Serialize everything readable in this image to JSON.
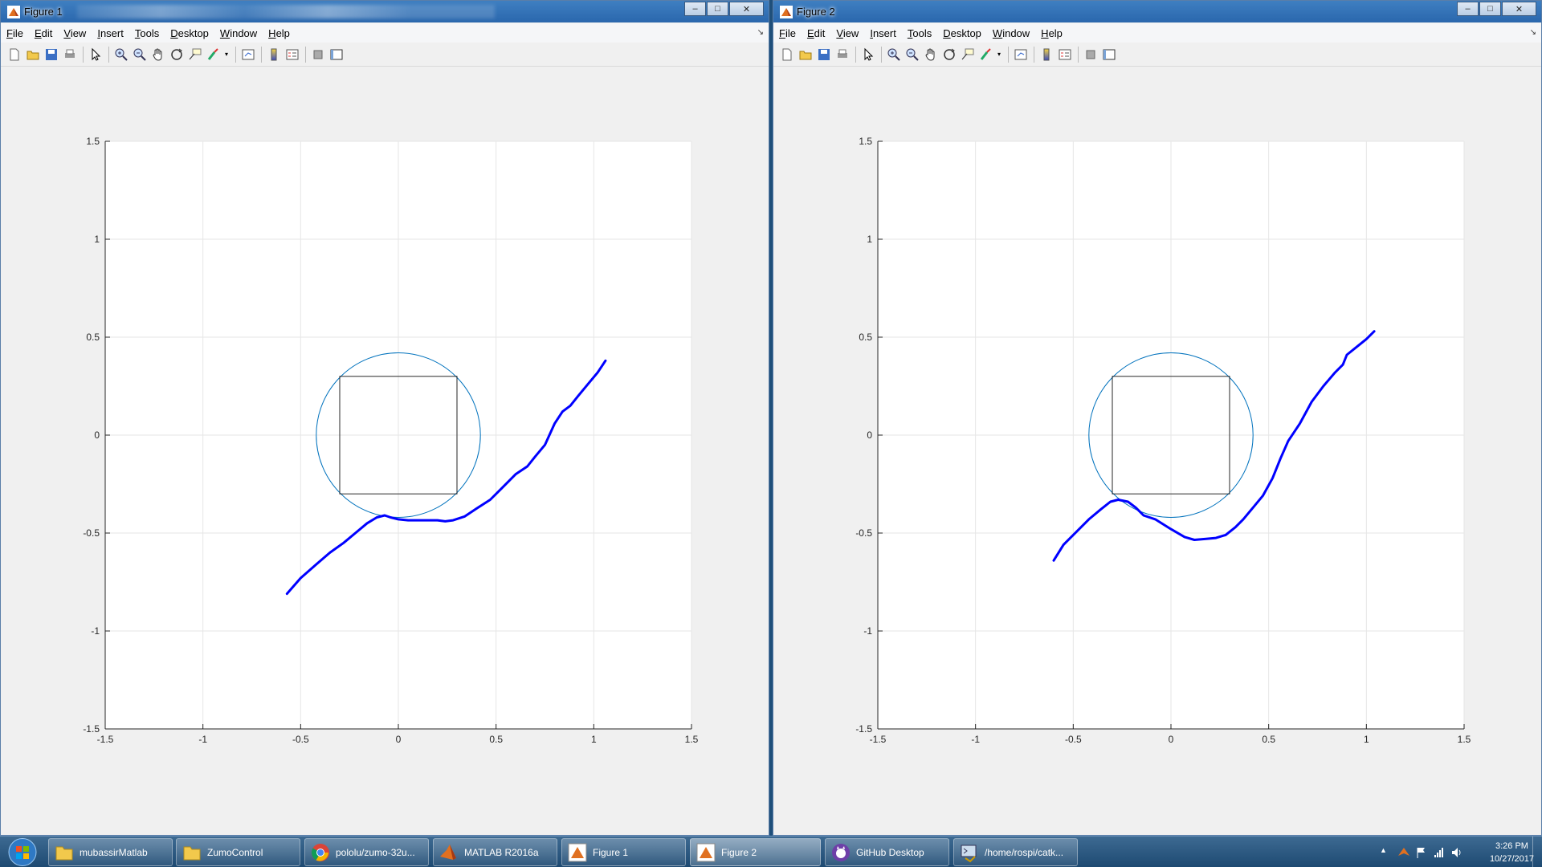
{
  "windows": [
    {
      "title": "Figure 1",
      "menu": [
        "File",
        "Edit",
        "View",
        "Insert",
        "Tools",
        "Desktop",
        "Window",
        "Help"
      ],
      "chart_data": {
        "type": "line",
        "title": "",
        "xlabel": "",
        "ylabel": "",
        "xlim": [
          -1.5,
          1.5
        ],
        "ylim": [
          -1.5,
          1.5
        ],
        "xticks": [
          "-1.5",
          "-1",
          "-0.5",
          "0",
          "0.5",
          "1",
          "1.5"
        ],
        "yticks": [
          "-1.5",
          "-1",
          "-0.5",
          "0",
          "0.5",
          "1",
          "1.5"
        ],
        "grid": true,
        "circle": {
          "center": [
            0,
            0
          ],
          "radius": 0.42,
          "color": "#0072bd"
        },
        "square": {
          "x": [
            -0.3,
            0.3
          ],
          "y": [
            -0.3,
            0.3
          ],
          "color": "#262626"
        },
        "series": [
          {
            "color": "#0000ff",
            "x": [
              -0.57,
              -0.5,
              -0.42,
              -0.35,
              -0.28,
              -0.22,
              -0.16,
              -0.11,
              -0.07,
              -0.04,
              0.0,
              0.05,
              0.12,
              0.2,
              0.24,
              0.28,
              0.34,
              0.4,
              0.47,
              0.53,
              0.6,
              0.66,
              0.7,
              0.75,
              0.8,
              0.84,
              0.88,
              0.92,
              0.97,
              1.02,
              1.06
            ],
            "y": [
              -0.81,
              -0.73,
              -0.66,
              -0.6,
              -0.55,
              -0.5,
              -0.45,
              -0.42,
              -0.41,
              -0.42,
              -0.43,
              -0.435,
              -0.435,
              -0.435,
              -0.44,
              -0.435,
              -0.415,
              -0.375,
              -0.33,
              -0.27,
              -0.2,
              -0.16,
              -0.11,
              -0.05,
              0.06,
              0.12,
              0.15,
              0.2,
              0.26,
              0.32,
              0.38
            ]
          }
        ]
      }
    },
    {
      "title": "Figure 2",
      "menu": [
        "File",
        "Edit",
        "View",
        "Insert",
        "Tools",
        "Desktop",
        "Window",
        "Help"
      ],
      "chart_data": {
        "type": "line",
        "title": "",
        "xlabel": "",
        "ylabel": "",
        "xlim": [
          -1.5,
          1.5
        ],
        "ylim": [
          -1.5,
          1.5
        ],
        "xticks": [
          "-1.5",
          "-1",
          "-0.5",
          "0",
          "0.5",
          "1",
          "1.5"
        ],
        "yticks": [
          "-1.5",
          "-1",
          "-0.5",
          "0",
          "0.5",
          "1",
          "1.5"
        ],
        "grid": true,
        "circle": {
          "center": [
            0,
            0
          ],
          "radius": 0.42,
          "color": "#0072bd"
        },
        "square": {
          "x": [
            -0.3,
            0.3
          ],
          "y": [
            -0.3,
            0.3
          ],
          "color": "#262626"
        },
        "series": [
          {
            "color": "#0000ff",
            "x": [
              -0.6,
              -0.55,
              -0.48,
              -0.42,
              -0.36,
              -0.31,
              -0.27,
              -0.22,
              -0.18,
              -0.14,
              -0.08,
              0.0,
              0.07,
              0.12,
              0.18,
              0.23,
              0.28,
              0.33,
              0.37,
              0.42,
              0.47,
              0.52,
              0.56,
              0.6,
              0.66,
              0.72,
              0.78,
              0.84,
              0.88,
              0.9,
              0.95,
              1.0,
              1.04
            ],
            "y": [
              -0.64,
              -0.56,
              -0.49,
              -0.43,
              -0.38,
              -0.34,
              -0.33,
              -0.34,
              -0.37,
              -0.41,
              -0.43,
              -0.48,
              -0.52,
              -0.535,
              -0.53,
              -0.525,
              -0.51,
              -0.47,
              -0.43,
              -0.37,
              -0.31,
              -0.22,
              -0.12,
              -0.03,
              0.06,
              0.17,
              0.25,
              0.32,
              0.36,
              0.41,
              0.45,
              0.49,
              0.53
            ]
          }
        ]
      }
    }
  ],
  "taskbar": {
    "items": [
      {
        "label": "mubassirMatlab",
        "icon": "folder-icon"
      },
      {
        "label": "ZumoControl",
        "icon": "folder-icon"
      },
      {
        "label": "pololu/zumo-32u...",
        "icon": "chrome-icon"
      },
      {
        "label": "MATLAB R2016a",
        "icon": "matlab-icon"
      },
      {
        "label": "Figure 1",
        "icon": "figure-icon"
      },
      {
        "label": "Figure 2",
        "icon": "figure-icon"
      },
      {
        "label": "GitHub Desktop",
        "icon": "github-icon"
      },
      {
        "label": "/home/rospi/catk...",
        "icon": "terminal-icon"
      }
    ],
    "time": "3:26 PM",
    "date": "10/27/2017"
  }
}
